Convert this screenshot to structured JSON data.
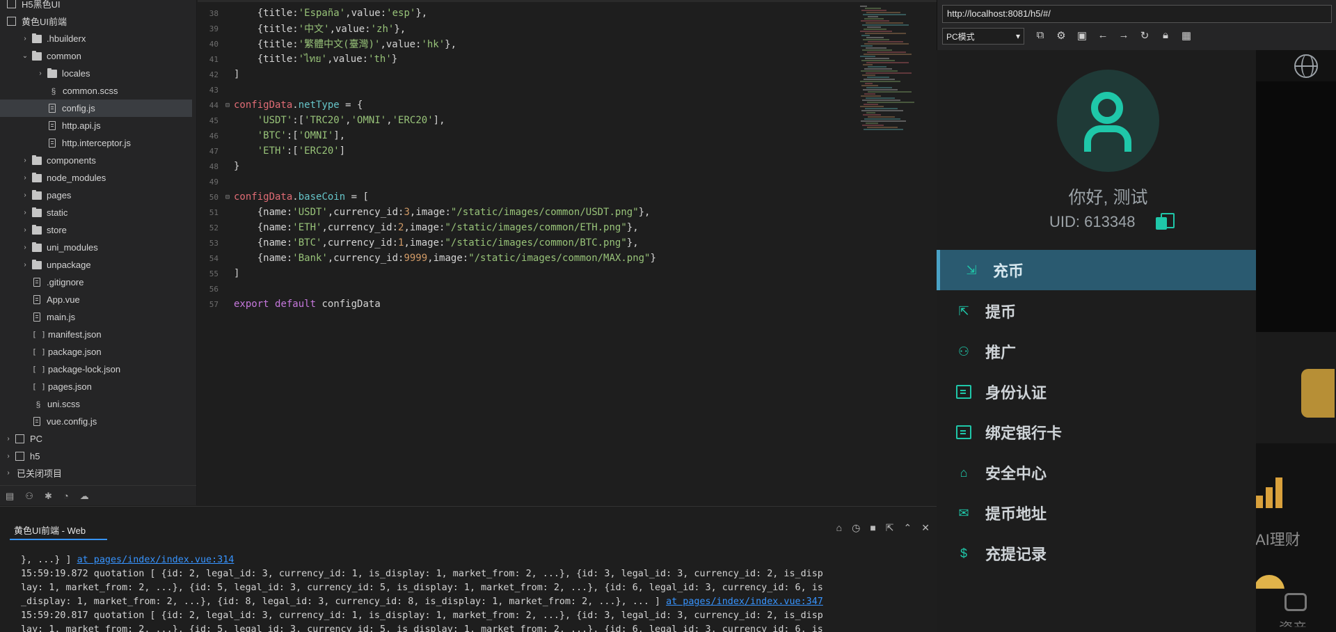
{
  "sidebar": {
    "project_top": "H5黑色UI",
    "project": "黄色UI前端",
    "items": [
      {
        "label": ".hbuilderx",
        "type": "folder"
      },
      {
        "label": "common",
        "type": "folder-open"
      },
      {
        "label": "locales",
        "type": "folder"
      },
      {
        "label": "common.scss",
        "type": "scss"
      },
      {
        "label": "config.js",
        "type": "file"
      },
      {
        "label": "http.api.js",
        "type": "file"
      },
      {
        "label": "http.interceptor.js",
        "type": "file"
      },
      {
        "label": "components",
        "type": "folder"
      },
      {
        "label": "node_modules",
        "type": "folder"
      },
      {
        "label": "pages",
        "type": "folder"
      },
      {
        "label": "static",
        "type": "folder"
      },
      {
        "label": "store",
        "type": "folder"
      },
      {
        "label": "uni_modules",
        "type": "folder"
      },
      {
        "label": "unpackage",
        "type": "folder"
      },
      {
        "label": ".gitignore",
        "type": "file"
      },
      {
        "label": "App.vue",
        "type": "file"
      },
      {
        "label": "main.js",
        "type": "file"
      },
      {
        "label": "manifest.json",
        "type": "json"
      },
      {
        "label": "package.json",
        "type": "json"
      },
      {
        "label": "package-lock.json",
        "type": "json"
      },
      {
        "label": "pages.json",
        "type": "json"
      },
      {
        "label": "uni.scss",
        "type": "scss"
      },
      {
        "label": "vue.config.js",
        "type": "file"
      }
    ],
    "project_pc": "PC",
    "project_h5": "h5",
    "closed_projects": "已关闭项目"
  },
  "editor": {
    "lines": [
      {
        "n": "38",
        "code": "    {title:'España',value:'esp'},"
      },
      {
        "n": "39",
        "code": "    {title:'中文',value:'zh'},"
      },
      {
        "n": "40",
        "code": "    {title:'繁體中文(臺灣)',value:'hk'},"
      },
      {
        "n": "41",
        "code": "    {title:'ไทย',value:'th'}"
      },
      {
        "n": "42",
        "code": "]"
      },
      {
        "n": "43",
        "code": ""
      },
      {
        "n": "44",
        "code": "configData.netType = {"
      },
      {
        "n": "45",
        "code": "    'USDT':['TRC20','OMNI','ERC20'],"
      },
      {
        "n": "46",
        "code": "    'BTC':['OMNI'],"
      },
      {
        "n": "47",
        "code": "    'ETH':['ERC20']"
      },
      {
        "n": "48",
        "code": "}"
      },
      {
        "n": "49",
        "code": ""
      },
      {
        "n": "50",
        "code": "configData.baseCoin = ["
      },
      {
        "n": "51",
        "code": "    {name:'USDT',currency_id:3,image:\"/static/images/common/USDT.png\"},"
      },
      {
        "n": "52",
        "code": "    {name:'ETH',currency_id:2,image:\"/static/images/common/ETH.png\"},"
      },
      {
        "n": "53",
        "code": "    {name:'BTC',currency_id:1,image:\"/static/images/common/BTC.png\"},"
      },
      {
        "n": "54",
        "code": "    {name:'Bank',currency_id:9999,image:\"/static/images/common/MAX.png\"}"
      },
      {
        "n": "55",
        "code": "]"
      },
      {
        "n": "56",
        "code": ""
      },
      {
        "n": "57",
        "code": "export default configData"
      }
    ]
  },
  "console": {
    "tab_label": "黄色UI前端 - Web",
    "lines": [
      {
        "text": "}, ...} ] ",
        "link": "at pages/index/index.vue:314"
      },
      {
        "text": "15:59:19.872 quotation [ {id: 2, legal_id: 3, currency_id: 1, is_display: 1, market_from: 2, ...}, {id: 3, legal_id: 3, currency_id: 2, is_disp",
        "link": ""
      },
      {
        "text": "lay: 1, market_from: 2, ...}, {id: 5, legal_id: 3, currency_id: 5, is_display: 1, market_from: 2, ...}, {id: 6, legal_id: 3, currency_id: 6, is",
        "link": ""
      },
      {
        "text": "_display: 1, market_from: 2, ...}, {id: 8, legal_id: 3, currency_id: 8, is_display: 1, market_from: 2, ...}, ... ] ",
        "link": "at pages/index/index.vue:347"
      },
      {
        "text": "15:59:20.817 quotation [ {id: 2, legal_id: 3, currency_id: 1, is_display: 1, market_from: 2, ...}, {id: 3, legal_id: 3, currency_id: 2, is_disp",
        "link": ""
      },
      {
        "text": "lay: 1, market_from: 2, ...}, {id: 5, legal_id: 3, currency_id: 5, is_display: 1, market_from: 2, ...}, {id: 6, legal_id: 3, currency_id: 6, is",
        "link": ""
      }
    ]
  },
  "browser": {
    "url": "http://localhost:8081/h5/#/",
    "mode": "PC模式",
    "toolbar_icons": [
      "screenshot-icon",
      "settings-icon",
      "console-icon",
      "back-icon",
      "forward-icon",
      "refresh-icon",
      "lock-icon",
      "qrcode-icon"
    ]
  },
  "app": {
    "greeting": "你好, 测试",
    "uid": "UID: 613348",
    "menu": [
      {
        "label": "充币",
        "icon": "deposit-icon",
        "active": true
      },
      {
        "label": "提币",
        "icon": "withdraw-icon",
        "active": false
      },
      {
        "label": "推广",
        "icon": "promote-icon",
        "active": false
      },
      {
        "label": "身份认证",
        "icon": "id-card-icon",
        "active": false
      },
      {
        "label": "绑定银行卡",
        "icon": "bank-card-icon",
        "active": false
      },
      {
        "label": "安全中心",
        "icon": "security-icon",
        "active": false
      },
      {
        "label": "提币地址",
        "icon": "address-icon",
        "active": false
      },
      {
        "label": "充提记录",
        "icon": "record-icon",
        "active": false
      }
    ],
    "background_labels": {
      "ai_wealth": "AI理财",
      "assets": "资产"
    },
    "colors": {
      "accent": "#1fc7a9",
      "active_bg": "#2a5a70",
      "gold": "#d9a13c"
    }
  }
}
